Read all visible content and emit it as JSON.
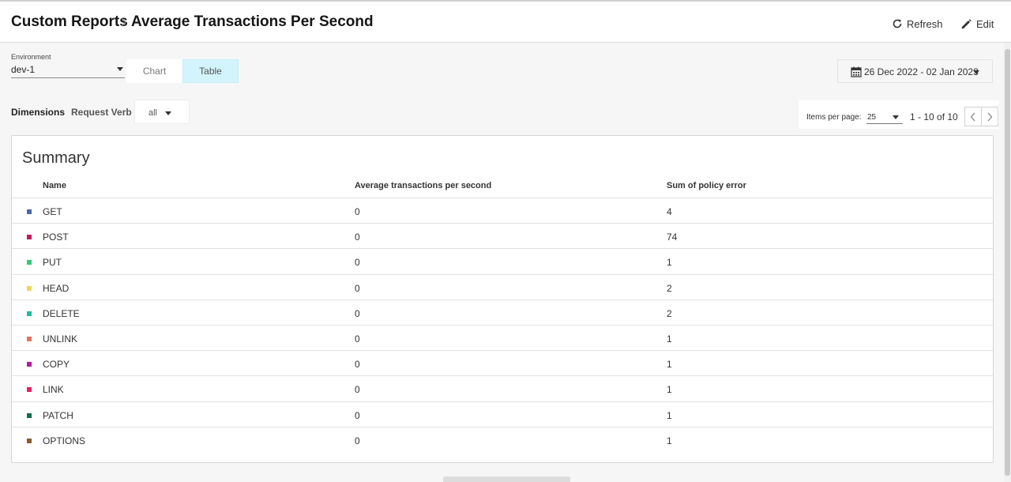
{
  "header": {
    "breadcrumb_root": "Custom Reports",
    "title": "Average Transactions Per Second",
    "refresh_label": "Refresh",
    "edit_label": "Edit"
  },
  "filters": {
    "environment_label": "Environment",
    "environment_value": "dev-1",
    "view_chart_label": "Chart",
    "view_table_label": "Table",
    "active_view": "Table",
    "date_range": "26 Dec 2022 - 02 Jan 2023",
    "dimensions_label": "Dimensions",
    "dimension_name": "Request Verb",
    "dimension_value": "all"
  },
  "pagination": {
    "items_per_page_label": "Items per page:",
    "items_per_page": "25",
    "range": "1 - 10 of 10"
  },
  "summary": {
    "title": "Summary",
    "columns": [
      "Name",
      "Average transactions per second",
      "Sum of policy error"
    ],
    "rows": [
      {
        "name": "GET",
        "avg": "0",
        "sum": "4",
        "color": "#4a68b0"
      },
      {
        "name": "POST",
        "avg": "0",
        "sum": "74",
        "color": "#c2185b"
      },
      {
        "name": "PUT",
        "avg": "0",
        "sum": "1",
        "color": "#2ecc71"
      },
      {
        "name": "HEAD",
        "avg": "0",
        "sum": "2",
        "color": "#f4d35e"
      },
      {
        "name": "DELETE",
        "avg": "0",
        "sum": "2",
        "color": "#1abc9c"
      },
      {
        "name": "UNLINK",
        "avg": "0",
        "sum": "1",
        "color": "#e8735a"
      },
      {
        "name": "COPY",
        "avg": "0",
        "sum": "1",
        "color": "#b5179e"
      },
      {
        "name": "LINK",
        "avg": "0",
        "sum": "1",
        "color": "#e91e63"
      },
      {
        "name": "PATCH",
        "avg": "0",
        "sum": "1",
        "color": "#0b6e4f"
      },
      {
        "name": "OPTIONS",
        "avg": "0",
        "sum": "1",
        "color": "#8b5a2b"
      }
    ]
  },
  "icons": {
    "refresh": "refresh-icon",
    "edit": "pencil-icon",
    "calendar": "calendar-icon",
    "prev": "chevron-left-icon",
    "next": "chevron-right-icon"
  }
}
